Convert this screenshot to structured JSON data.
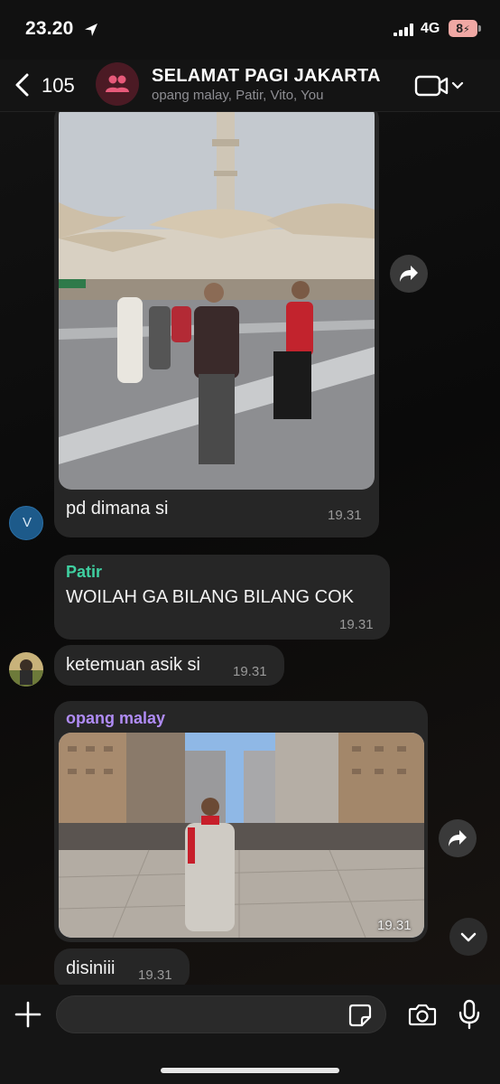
{
  "status_bar": {
    "time": "23.20",
    "network": "4G",
    "battery": "8"
  },
  "header": {
    "back_count": "105",
    "group_name": "SELAMAT PAGI JAKARTA",
    "members": "opang malay, Patir, Vito, You"
  },
  "messages": [
    {
      "type": "photo",
      "sender_avatar": "V",
      "caption": "pd dimana si",
      "time": "19.31"
    },
    {
      "type": "text",
      "sender": "Patir",
      "sender_color": "#3fcfa0",
      "text": "WOILAH GA BILANG BILANG COK",
      "time": "19.31"
    },
    {
      "type": "text",
      "text": "ketemuan asik si",
      "time": "19.31"
    },
    {
      "type": "photo",
      "sender": "opang malay",
      "sender_color": "#b08cf5",
      "photo_time": "19.31"
    },
    {
      "type": "text",
      "text": "disiniii",
      "time": "19.31"
    }
  ],
  "composer": {
    "placeholder": ""
  },
  "colors": {
    "bubble": "#262626",
    "background": "#0b0b0b",
    "patir": "#3fcfa0",
    "opang": "#b08cf5"
  }
}
